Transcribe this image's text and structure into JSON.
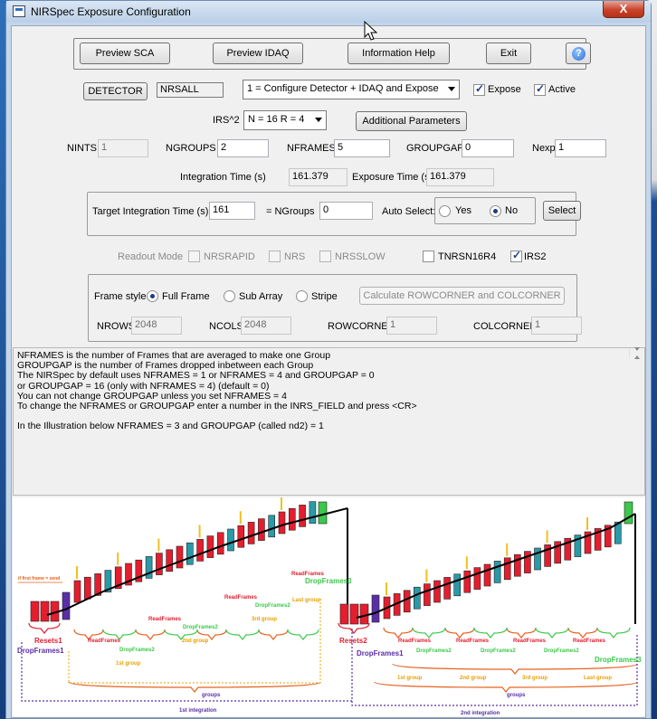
{
  "window": {
    "title": "NIRSpec Exposure Configuration",
    "close_glyph": "X"
  },
  "toolbar": {
    "preview_sca": "Preview SCA",
    "preview_idaq": "Preview IDAQ",
    "info_help": "Information  Help",
    "exit": "Exit",
    "help_glyph": "?"
  },
  "detector": {
    "button": "DETECTOR",
    "value": "NRSALL",
    "mode": "1 = Configure Detector + IDAQ and Expose",
    "expose_label": "Expose",
    "expose_checked": true,
    "active_label": "Active",
    "active_checked": true
  },
  "irs": {
    "label": "IRS^2",
    "value": "N = 16  R = 4",
    "additional": "Additional Parameters"
  },
  "params": {
    "nints_label": "NINTS",
    "nints": "1",
    "ngroups_label": "NGROUPS",
    "ngroups": "2",
    "nframes_label": "NFRAMES",
    "nframes": "5",
    "groupgap_label": "GROUPGAP",
    "groupgap": "0",
    "nexp_label": "Nexp",
    "nexp": "1"
  },
  "times": {
    "integration_label": "Integration Time (s)",
    "integration": "161.379",
    "exposure_label": "Exposure Time (s)",
    "exposure": "161.379"
  },
  "target": {
    "label": "Target Integration Time (s)",
    "value": "161",
    "eq_label": "= NGroups",
    "ngroups": "0",
    "auto_label": "Auto Select:",
    "yes": "Yes",
    "no": "No",
    "selected": "No",
    "select_button": "Select"
  },
  "readout": {
    "label": "Readout Mode",
    "nrsrapid": "NRSRAPID",
    "nrs": "NRS",
    "nrsslow": "NRSSLOW",
    "tnrsn16r4": "TNRSN16R4",
    "irs2": "IRS2",
    "irs2_checked": true
  },
  "frame": {
    "label": "Frame style",
    "full": "Full Frame",
    "sub": "Sub Array",
    "stripe": "Stripe",
    "selected": "Full Frame",
    "calc_button": "Calculate  ROWCORNER and COLCORNER",
    "nrows_label": "NROWS",
    "nrows": "2048",
    "ncols_label": "NCOLS",
    "ncols": "2048",
    "rowcorner_label": "ROWCORNER",
    "rowcorner": "1",
    "colcorner_label": "COLCORNER",
    "colcorner": "1"
  },
  "info_lines": [
    "NFRAMES is the number of Frames that are averaged to make one Group",
    "GROUPGAP is the number of Frames dropped inbetween each Group",
    "The NIRSpec by default uses NFRAMES = 1 or NFRAMES = 4 and GROUPGAP = 0",
    "or GROUPGAP = 16 (only with NFRAMES = 4) (default = 0)",
    "You can not change GROUPGAP unless you set NFRAMES = 4",
    "To change the NFRAMES or GROUPGAP enter a number in the INRS_FIELD and press <CR>",
    "",
    "In the Illustration below NFRAMES = 3 and GROUPGAP (called nd2) = 1"
  ],
  "illustration": {
    "first_frame_note": "if first frame = send",
    "resets1": "Resets1",
    "dropframes1": "DropFrames1",
    "readframes": "ReadFrames",
    "dropframes2": "DropFrames2",
    "group1": "1st group",
    "group2": "2nd group",
    "group3": "3rd group",
    "last_group": "Last group",
    "dropframes3": "DropFrames3",
    "groups": "groups",
    "integration1": "1st integration",
    "resets2": "Resets2",
    "integration2": "2nd integration",
    "colors": {
      "red": "#e41e2e",
      "teal": "#2a9aa8",
      "purple": "#5a2ea6",
      "green": "#3cc84a",
      "orange": "#e8601c",
      "yellow": "#f0c020"
    }
  }
}
